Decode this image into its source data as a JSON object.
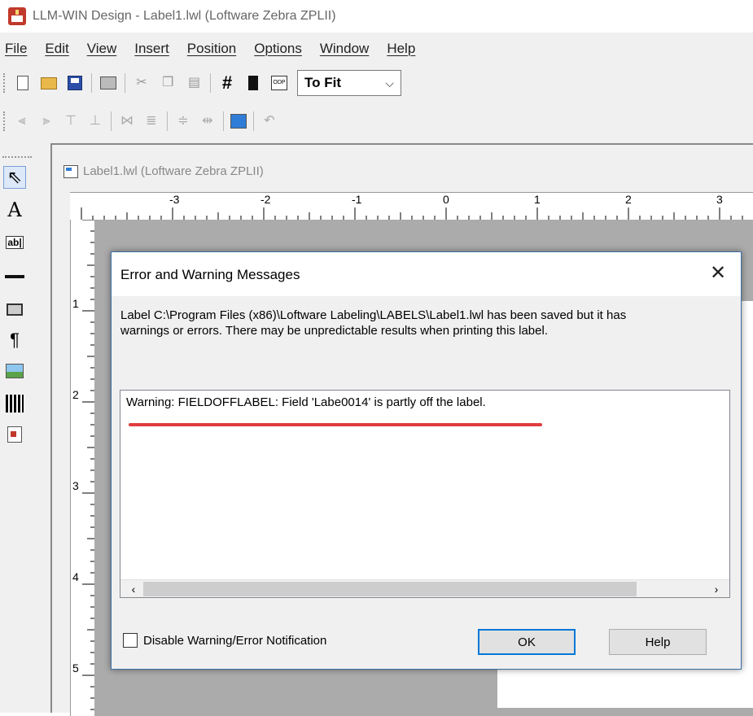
{
  "window": {
    "title": "LLM-WIN Design - Label1.lwl (Loftware Zebra ZPLII)"
  },
  "menu": [
    "File",
    "Edit",
    "View",
    "Insert",
    "Position",
    "Options",
    "Window",
    "Help"
  ],
  "toolbar": {
    "zoom_value": "To Fit",
    "odp_label": "ODP"
  },
  "document": {
    "title": "Label1.lwl (Loftware Zebra ZPLII)"
  },
  "ruler": {
    "horizontal_labels": [
      "-3",
      "-2",
      "-1",
      "0",
      "1",
      "2",
      "3"
    ],
    "vertical_labels": [
      "1",
      "2",
      "3",
      "4",
      "5"
    ]
  },
  "dialog": {
    "title": "Error and Warning Messages",
    "message_line1": "Label C:\\Program Files (x86)\\Loftware Labeling\\LABELS\\Label1.lwl has been saved but it has",
    "message_line2": "warnings or errors.  There may be unpredictable results when printing this label.",
    "warnings": [
      "Warning: FIELDOFFLABEL: Field 'Labe0014' is partly off the label."
    ],
    "checkbox_label": "Disable Warning/Error Notification",
    "ok_label": "OK",
    "help_label": "Help",
    "annotation_color": "#e03c3c"
  }
}
